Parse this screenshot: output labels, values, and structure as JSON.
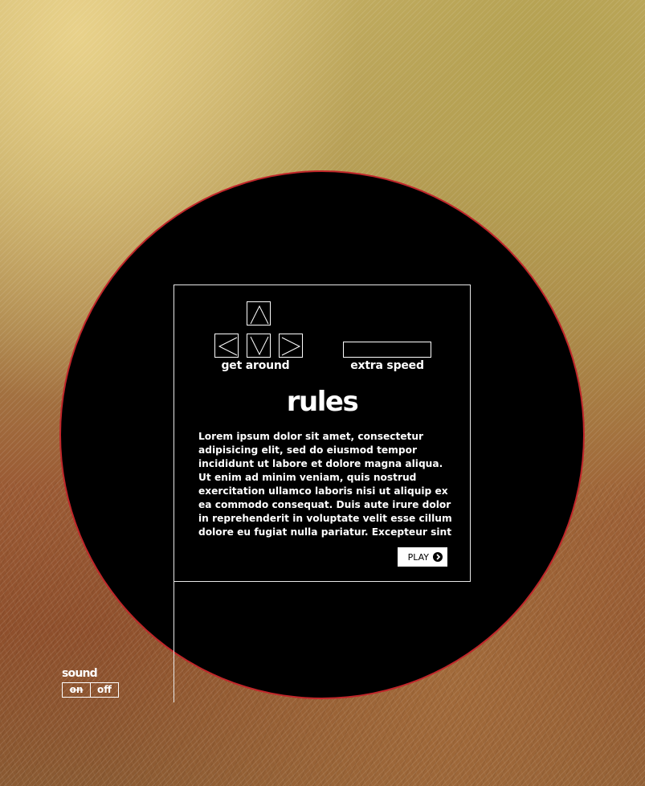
{
  "controls": {
    "arrows_label": "get around",
    "arrow_icons": [
      "arrow-up-icon",
      "arrow-left-icon",
      "arrow-down-icon",
      "arrow-right-icon"
    ],
    "space_label": "extra speed"
  },
  "rules": {
    "title": "rules",
    "body": "Lorem ipsum dolor sit amet, consectetur adipisicing elit, sed do eiusmod tempor incididunt ut labore et dolore magna aliqua. Ut enim ad minim veniam, quis nostrud exercitation ullamco laboris nisi ut aliquip ex ea commodo consequat. Duis aute irure dolor in reprehenderit in voluptate velit esse cillum dolore eu fugiat nulla pariatur. Excepteur sint",
    "play_label": "PLAY",
    "play_icon": "chevron-right-circle-icon"
  },
  "sound": {
    "label": "sound",
    "on_label": "on",
    "off_label": "off",
    "selected": "off"
  },
  "colors": {
    "circle_fill": "#000000",
    "circle_border": "#c0262a",
    "text": "#ffffff"
  }
}
